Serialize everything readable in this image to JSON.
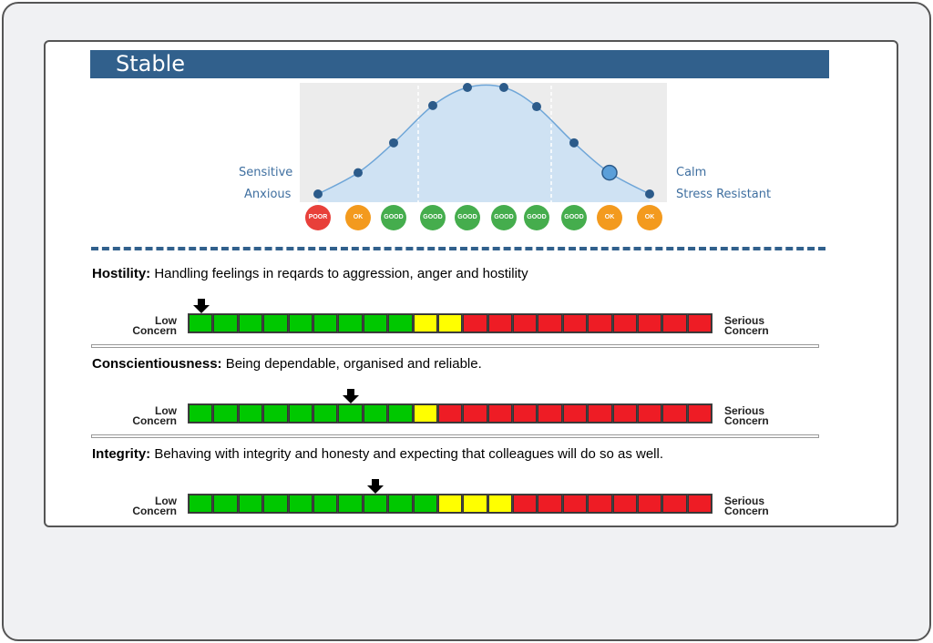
{
  "section_title": "Stable",
  "chart_data": {
    "type": "area",
    "title": "",
    "left_labels": [
      "Sensitive",
      "Anxious"
    ],
    "right_labels": [
      "Calm",
      "Stress Resistant"
    ],
    "points_relative_height": [
      0,
      0.2,
      0.48,
      0.83,
      1,
      1,
      0.82,
      0.48,
      0.2,
      0
    ],
    "highlighted_index": 8,
    "ratings": [
      "POOR",
      "OK",
      "GOOD",
      "GOOD",
      "GOOD",
      "GOOD",
      "GOOD",
      "GOOD",
      "OK",
      "OK"
    ],
    "rating_colors": {
      "POOR": "#e8403a",
      "OK": "#f39a1e",
      "GOOD": "#45ad4d"
    },
    "fill_color": "#cfe2f3",
    "line_color": "#6fa6d8",
    "point_color": "#2c5b8a"
  },
  "scales": [
    {
      "label": "Hostility:",
      "description": " Handling feelings in reqards to aggression, anger and hostility",
      "green": 9,
      "yellow": 2,
      "red": 10,
      "marker_cell": 1
    },
    {
      "label": "Conscientiousness:",
      "description": " Being dependable, organised and reliable.",
      "green": 9,
      "yellow": 1,
      "red": 11,
      "marker_cell": 7
    },
    {
      "label": "Integrity:",
      "description": " Behaving with integrity and honesty and expecting that colleagues will do so as well.",
      "green": 10,
      "yellow": 3,
      "red": 8,
      "marker_cell": 8
    }
  ],
  "scale_low_label": [
    "Low",
    "Concern"
  ],
  "scale_high_label": [
    "Serious",
    "Concern"
  ],
  "colors": {
    "green": "#00c800",
    "yellow": "#ffff00",
    "red": "#ee1c25",
    "banner": "#31608c"
  }
}
